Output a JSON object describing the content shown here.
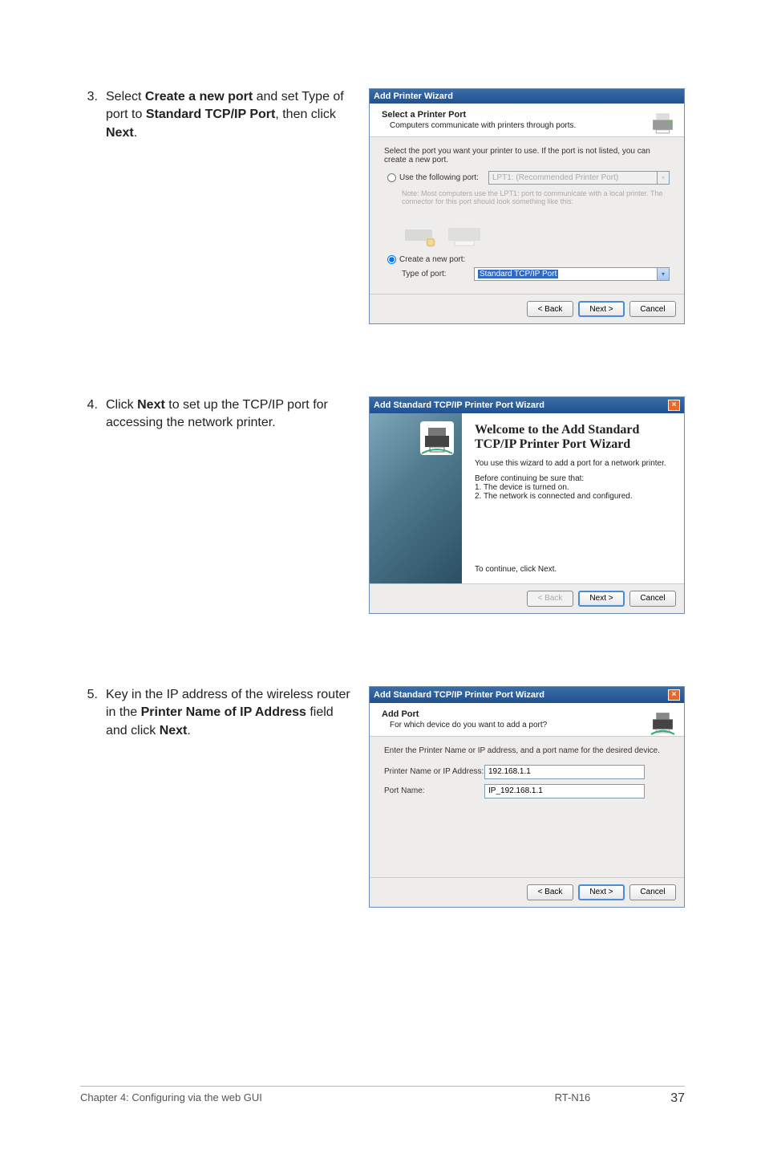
{
  "step3": {
    "num": "3.",
    "text_a": "Select ",
    "text_b": "Create a new port",
    "text_c": " and set Type of port to ",
    "text_d": "Standard TCP/IP Port",
    "text_e": ", then click ",
    "text_f": "Next",
    "text_g": "."
  },
  "step4": {
    "num": "4.",
    "text_a": "Click ",
    "text_b": "Next",
    "text_c": " to set up the TCP/IP port for accessing the network printer."
  },
  "step5": {
    "num": "5.",
    "text_a": "Key in the IP address of the wireless router in the ",
    "text_b": "Printer Name of IP Address",
    "text_c": " field and click ",
    "text_d": "Next",
    "text_e": "."
  },
  "dlg1": {
    "title": "Add Printer Wizard",
    "headerTitle": "Select a Printer Port",
    "headerSub": "Computers communicate with printers through ports.",
    "intro": "Select the port you want your printer to use.  If the port is not listed, you can create a new port.",
    "useFollowing": "Use the following port:",
    "lpt": "LPT1: (Recommended Printer Port)",
    "note": "Note: Most computers use the LPT1: port to communicate with a local printer. The connector for this port should look something like this:",
    "createNew": "Create a new port:",
    "typeOfPort": "Type of port:",
    "stdTcp": "Standard TCP/IP Port",
    "back": "< Back",
    "next": "Next >",
    "cancel": "Cancel"
  },
  "dlg2": {
    "title": "Add Standard TCP/IP Printer Port Wizard",
    "welcomeTitle": "Welcome to the Add Standard TCP/IP Printer Port Wizard",
    "line1": "You use this wizard to add a port for a network printer.",
    "beforeHdr": "Before continuing be sure that:",
    "before1": "1.  The device is turned on.",
    "before2": "2.  The network is connected and configured.",
    "continue": "To continue, click Next.",
    "back": "< Back",
    "next": "Next >",
    "cancel": "Cancel"
  },
  "dlg3": {
    "title": "Add Standard TCP/IP Printer Port Wizard",
    "headerTitle": "Add Port",
    "headerSub": "For which device do you want to add a port?",
    "intro": "Enter the Printer Name or IP address, and a port name for the desired device.",
    "addrLabel": "Printer Name or IP Address:",
    "addrValue": "192.168.1.1",
    "portLabel": "Port Name:",
    "portValue": "IP_192.168.1.1",
    "back": "< Back",
    "next": "Next >",
    "cancel": "Cancel"
  },
  "footer": {
    "left": "Chapter 4: Configuring via the web GUI",
    "mid": "RT-N16",
    "page": "37"
  }
}
